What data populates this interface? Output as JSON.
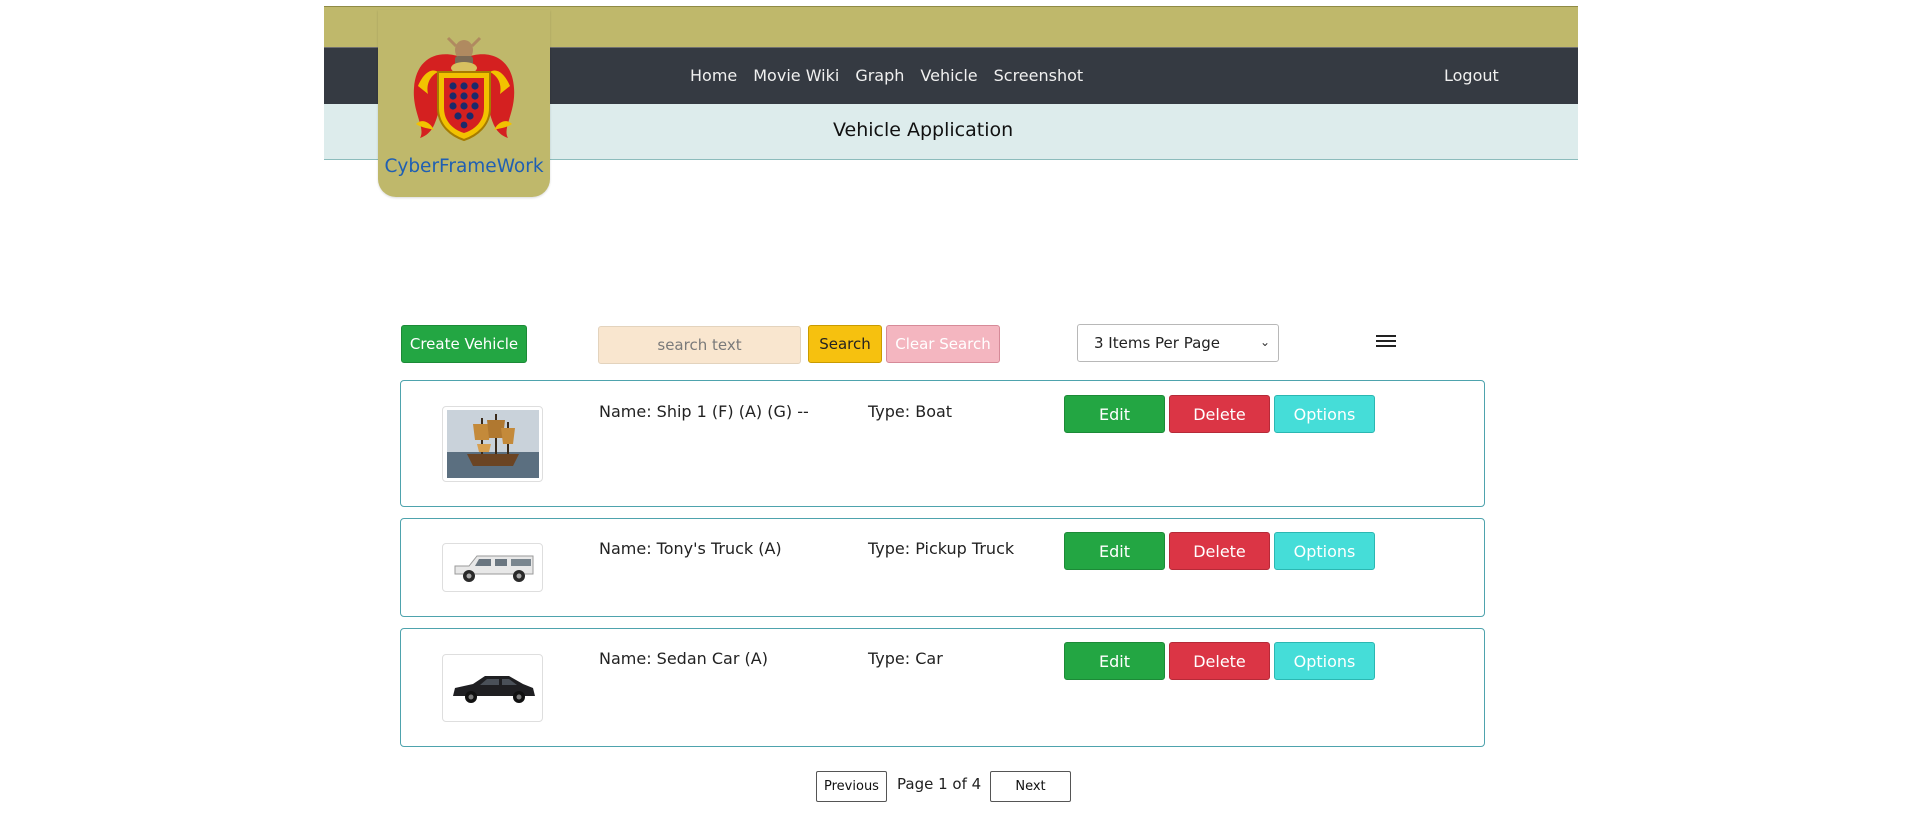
{
  "header": {
    "brand": "CyberFrameWork",
    "nav": [
      "Home",
      "Movie Wiki",
      "Graph",
      "Vehicle",
      "Screenshot"
    ],
    "logout": "Logout",
    "app_title": "Vehicle Application"
  },
  "toolbar": {
    "create_label": "Create Vehicle",
    "search_placeholder": "search text",
    "search_label": "Search",
    "clear_label": "Clear Search",
    "per_page_selected": "3 Items Per Page"
  },
  "vehicles": [
    {
      "name": "Name: Ship 1 (F) (A) (G) --",
      "type": "Type: Boat",
      "image": "ship-photo"
    },
    {
      "name": "Name: Tony's Truck (A)",
      "type": "Type: Pickup Truck",
      "image": "pickup-truck-photo"
    },
    {
      "name": "Name: Sedan Car (A)",
      "type": "Type: Car",
      "image": "sedan-car-photo"
    }
  ],
  "row_actions": {
    "edit": "Edit",
    "delete": "Delete",
    "options": "Options"
  },
  "pagination": {
    "previous": "Previous",
    "info": "Page 1 of 4",
    "next": "Next"
  },
  "colors": {
    "header_gold": "#bfb86b",
    "navbar": "#353a42",
    "subbar": "#ddecec",
    "brand_text": "#1f5fb3",
    "success": "#23a643",
    "danger": "#db3545",
    "info": "#45ddd8",
    "warning": "#f6c10f"
  }
}
